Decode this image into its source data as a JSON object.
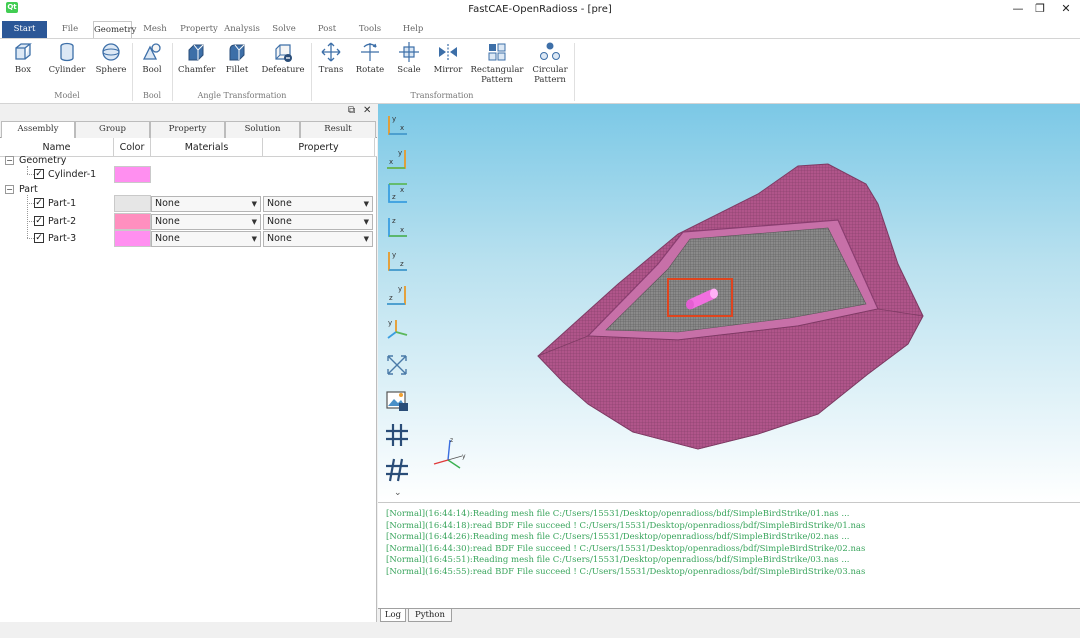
{
  "window": {
    "title": "FastCAE-OpenRadioss - [pre]",
    "logo": "Qt",
    "minimize_glyph": "—",
    "restore_glyph": "❐",
    "close_glyph": "✕",
    "mdi_controls": "▁⧉✕"
  },
  "menu": {
    "tabs": [
      "Start",
      "File",
      "Geometry",
      "Mesh",
      "Property",
      "Analysis",
      "Solve",
      "Post",
      "Tools",
      "Help"
    ],
    "active_tab": "Geometry"
  },
  "ribbon": {
    "groups": {
      "model": "Model",
      "bool": "Bool",
      "angle": "Angle Transformation",
      "transformation": "Transformation"
    },
    "buttons": {
      "box": "Box",
      "cylinder": "Cylinder",
      "sphere": "Sphere",
      "bool": "Bool",
      "chamfer": "Chamfer",
      "fillet": "Fillet",
      "defeature": "Defeature",
      "trans": "Trans",
      "rotate": "Rotate",
      "scale": "Scale",
      "mirror": "Mirror",
      "rect_pattern_1": "Rectangular",
      "rect_pattern_2": "Pattern",
      "circ_pattern_1": "Circular",
      "circ_pattern_2": "Pattern"
    }
  },
  "panel": {
    "float_glyph": "⧉",
    "close_glyph": "✕",
    "tabs": [
      "Assembly",
      "Group",
      "Property",
      "Solution",
      "Result"
    ],
    "active_tab": "Assembly",
    "columns": [
      "Name",
      "Color",
      "Materials",
      "Property"
    ],
    "tree": {
      "geometry_label": "Geometry",
      "cylinder_label": "Cylinder-1",
      "part_label": "Part",
      "parts": [
        {
          "name": "Part-1",
          "material": "None",
          "property": "None",
          "checked": true
        },
        {
          "name": "Part-2",
          "material": "None",
          "property": "None",
          "checked": true
        },
        {
          "name": "Part-3",
          "material": "None",
          "property": "None",
          "checked": true
        }
      ],
      "collapse_glyph": "−",
      "check_glyph": "✓",
      "dropdown_glyph": "▼"
    }
  },
  "colors": {
    "start_tab": "#2b5797",
    "mesh_pink": "#b0558a",
    "cylinder_color": "#ff8ff0",
    "part1_color": "#e6e6e6",
    "part2_color": "#ff8fbf",
    "part3_color": "#ff8ff0",
    "log_green": "#3aa55d"
  },
  "viewport": {
    "view_tools": [
      "view-front-yx-icon",
      "view-back-xy-icon",
      "view-top-zx-icon",
      "view-bottom-zx-icon",
      "view-left-yz-icon",
      "view-right-zy-icon",
      "view-iso-icon",
      "fit-view-icon",
      "screenshot-icon",
      "mesh-grid-icon",
      "mesh-grid-alt-icon"
    ],
    "more_glyph": "⌄"
  },
  "console": {
    "lines": [
      "[Normal](16:44:14):Reading mesh file C:/Users/15531/Desktop/openradioss/bdf/SimpleBirdStrike/01.nas ...",
      "[Normal](16:44:18):read BDF File succeed ! C:/Users/15531/Desktop/openradioss/bdf/SimpleBirdStrike/01.nas",
      "[Normal](16:44:26):Reading mesh file C:/Users/15531/Desktop/openradioss/bdf/SimpleBirdStrike/02.nas ...",
      "[Normal](16:44:30):read BDF File succeed ! C:/Users/15531/Desktop/openradioss/bdf/SimpleBirdStrike/02.nas",
      "[Normal](16:45:51):Reading mesh file C:/Users/15531/Desktop/openradioss/bdf/SimpleBirdStrike/03.nas ...",
      "[Normal](16:45:55):read BDF File succeed ! C:/Users/15531/Desktop/openradioss/bdf/SimpleBirdStrike/03.nas"
    ],
    "tabs": [
      "Log",
      "Python"
    ],
    "active_tab": "Log"
  }
}
